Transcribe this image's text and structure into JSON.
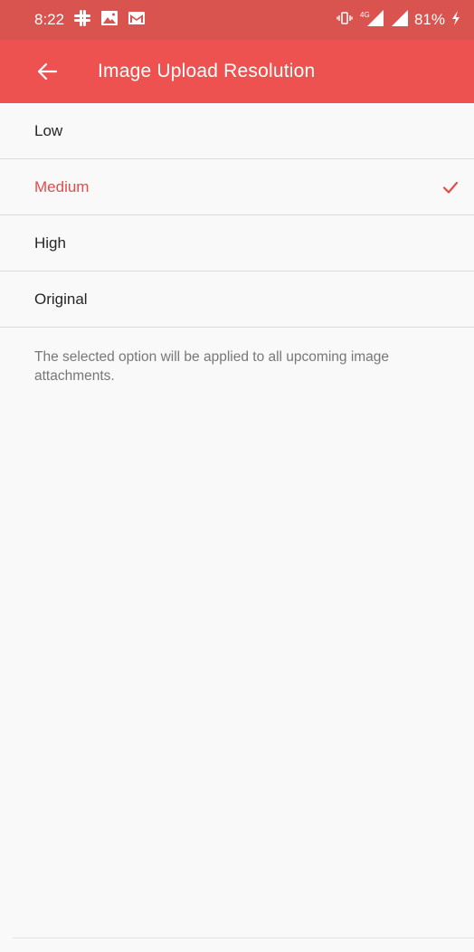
{
  "status_bar": {
    "time": "8:22",
    "battery": "81%",
    "network": "4G"
  },
  "app_bar": {
    "title": "Image Upload Resolution"
  },
  "options": [
    {
      "label": "Low",
      "selected": false
    },
    {
      "label": "Medium",
      "selected": true
    },
    {
      "label": "High",
      "selected": false
    },
    {
      "label": "Original",
      "selected": false
    }
  ],
  "note": "The selected option will be applied to all upcoming image attachments.",
  "colors": {
    "status_bar": "#d9534f",
    "app_bar": "#ee5250",
    "accent": "#e44c4a",
    "background": "#f9f9f9"
  }
}
